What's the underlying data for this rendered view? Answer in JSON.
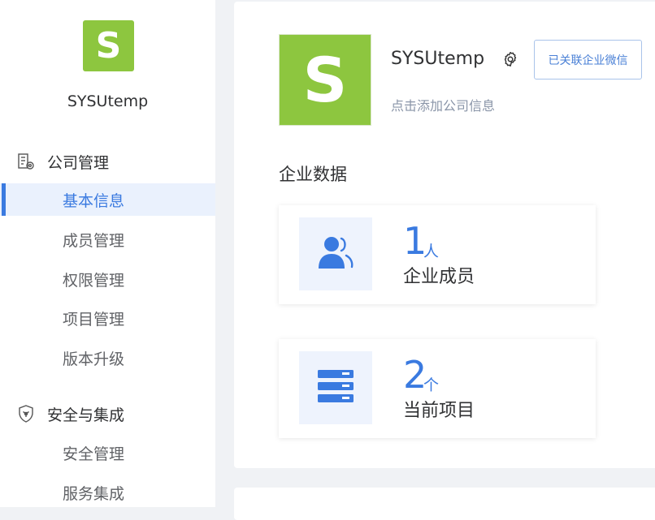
{
  "sidebar": {
    "logo_letter": "S",
    "company_name": "SYSUtemp",
    "groups": [
      {
        "title": "公司管理",
        "icon": "building-settings-icon",
        "items": [
          {
            "label": "基本信息",
            "active": true
          },
          {
            "label": "成员管理",
            "active": false
          },
          {
            "label": "权限管理",
            "active": false
          },
          {
            "label": "项目管理",
            "active": false
          },
          {
            "label": "版本升级",
            "active": false
          }
        ]
      },
      {
        "title": "安全与集成",
        "icon": "shield-icon",
        "items": [
          {
            "label": "安全管理",
            "active": false
          },
          {
            "label": "服务集成",
            "active": false
          }
        ]
      }
    ]
  },
  "company": {
    "logo_letter": "S",
    "name": "SYSUtemp",
    "add_info_link": "点击添加公司信息",
    "wechat_button": "已关联企业微信"
  },
  "enterprise_data": {
    "title": "企业数据",
    "stats": [
      {
        "value": "1",
        "unit": "人",
        "label": "企业成员",
        "icon": "members-icon"
      },
      {
        "value": "2",
        "unit": "个",
        "label": "当前项目",
        "icon": "server-stack-icon"
      }
    ]
  },
  "colors": {
    "brand_green": "#8dc63f",
    "accent_blue": "#3a7ae0",
    "active_bg": "#eaf1fd"
  }
}
